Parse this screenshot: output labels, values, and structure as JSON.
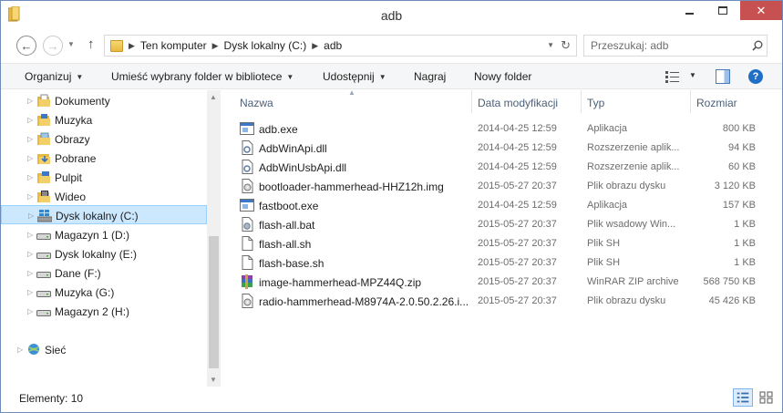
{
  "window": {
    "title": "adb"
  },
  "address": {
    "crumbs": [
      "Ten komputer",
      "Dysk lokalny (C:)",
      "adb"
    ],
    "search_placeholder": "Przeszukaj: adb"
  },
  "toolbar": {
    "organize": "Organizuj",
    "include_library": "Umieść wybrany folder w bibliotece",
    "share": "Udostępnij",
    "burn": "Nagraj",
    "new_folder": "Nowy folder"
  },
  "nav": {
    "items": [
      {
        "label": "Dokumenty",
        "icon": "documents-icon"
      },
      {
        "label": "Muzyka",
        "icon": "music-icon"
      },
      {
        "label": "Obrazy",
        "icon": "pictures-icon"
      },
      {
        "label": "Pobrane",
        "icon": "downloads-icon"
      },
      {
        "label": "Pulpit",
        "icon": "desktop-icon"
      },
      {
        "label": "Wideo",
        "icon": "videos-icon"
      },
      {
        "label": "Dysk lokalny (C:)",
        "icon": "windows-drive-icon",
        "selected": true
      },
      {
        "label": "Magazyn 1 (D:)",
        "icon": "drive-icon"
      },
      {
        "label": "Dysk lokalny (E:)",
        "icon": "drive-icon"
      },
      {
        "label": "Dane (F:)",
        "icon": "drive-icon"
      },
      {
        "label": "Muzyka (G:)",
        "icon": "drive-icon"
      },
      {
        "label": "Magazyn 2 (H:)",
        "icon": "drive-icon"
      }
    ],
    "network": "Sieć"
  },
  "columns": {
    "name": "Nazwa",
    "date": "Data modyfikacji",
    "type": "Typ",
    "size": "Rozmiar"
  },
  "files": [
    {
      "name": "adb.exe",
      "date": "2014-04-25 12:59",
      "type": "Aplikacja",
      "size": "800 KB",
      "icon": "exe-icon"
    },
    {
      "name": "AdbWinApi.dll",
      "date": "2014-04-25 12:59",
      "type": "Rozszerzenie aplik...",
      "size": "94 KB",
      "icon": "dll-icon"
    },
    {
      "name": "AdbWinUsbApi.dll",
      "date": "2014-04-25 12:59",
      "type": "Rozszerzenie aplik...",
      "size": "60 KB",
      "icon": "dll-icon"
    },
    {
      "name": "bootloader-hammerhead-HHZ12h.img",
      "date": "2015-05-27 20:37",
      "type": "Plik obrazu dysku",
      "size": "3 120 KB",
      "icon": "disk-image-icon"
    },
    {
      "name": "fastboot.exe",
      "date": "2014-04-25 12:59",
      "type": "Aplikacja",
      "size": "157 KB",
      "icon": "exe-icon"
    },
    {
      "name": "flash-all.bat",
      "date": "2015-05-27 20:37",
      "type": "Plik wsadowy Win...",
      "size": "1 KB",
      "icon": "bat-icon"
    },
    {
      "name": "flash-all.sh",
      "date": "2015-05-27 20:37",
      "type": "Plik SH",
      "size": "1 KB",
      "icon": "blank-file-icon"
    },
    {
      "name": "flash-base.sh",
      "date": "2015-05-27 20:37",
      "type": "Plik SH",
      "size": "1 KB",
      "icon": "blank-file-icon"
    },
    {
      "name": "image-hammerhead-MPZ44Q.zip",
      "date": "2015-05-27 20:37",
      "type": "WinRAR ZIP archive",
      "size": "568 750 KB",
      "icon": "winrar-icon"
    },
    {
      "name": "radio-hammerhead-M8974A-2.0.50.2.26.i...",
      "date": "2015-05-27 20:37",
      "type": "Plik obrazu dysku",
      "size": "45 426 KB",
      "icon": "disk-image-icon"
    }
  ],
  "status": {
    "count": "Elementy: 10"
  },
  "colors": {
    "accent": "#1f6fc5",
    "selection": "#cce8ff",
    "close": "#c75050"
  }
}
